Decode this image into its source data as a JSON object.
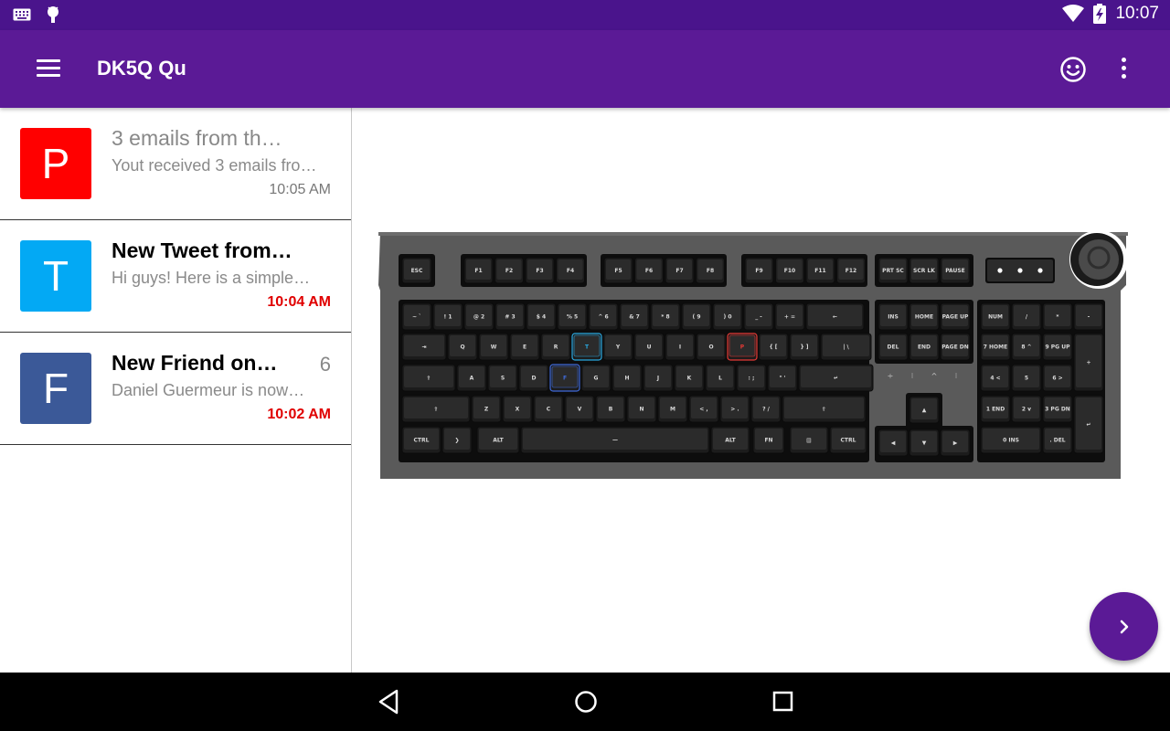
{
  "status_bar": {
    "time": "10:07"
  },
  "app_bar": {
    "title": "DK5Q Qu"
  },
  "list": {
    "items": [
      {
        "avatar_letter": "P",
        "avatar_color": "#ff0000",
        "title": "3 emails from th…",
        "preview": "Yout received 3 emails fro…",
        "time": "10:05 AM",
        "count": "",
        "unread": false
      },
      {
        "avatar_letter": "T",
        "avatar_color": "#03a9f4",
        "title": "New Tweet from…",
        "preview": "Hi guys! Here is a simple…",
        "time": "10:04 AM",
        "count": "",
        "unread": true
      },
      {
        "avatar_letter": "F",
        "avatar_color": "#3b5998",
        "title": "New Friend on…",
        "preview": "Daniel Guermeur is now…",
        "time": "10:02 AM",
        "count": "6",
        "unread": true
      }
    ]
  },
  "keyboard": {
    "function_row": [
      "ESC",
      "F1",
      "F2",
      "F3",
      "F4",
      "F5",
      "F6",
      "F7",
      "F8",
      "F9",
      "F10",
      "F11",
      "F12",
      "PRT SC",
      "SCR LK",
      "PAUSE"
    ],
    "row1": [
      "~ `",
      "! 1",
      "@ 2",
      "# 3",
      "$ 4",
      "% 5",
      "^ 6",
      "& 7",
      "* 8",
      "( 9",
      ") 0",
      "_ -",
      "+ ="
    ],
    "row2": [
      "Q",
      "W",
      "E",
      "R",
      "T",
      "Y",
      "U",
      "I",
      "O",
      "P",
      "{ [",
      "} ]",
      "| \\"
    ],
    "row3": [
      "A",
      "S",
      "D",
      "F",
      "G",
      "H",
      "J",
      "K",
      "L",
      ": ;",
      "\" '"
    ],
    "row4": [
      "Z",
      "X",
      "C",
      "V",
      "B",
      "N",
      "M",
      "< ,",
      "> .",
      "? /"
    ],
    "row5": [
      "CTRL",
      "ALT",
      "ALT",
      "FN",
      "CTRL"
    ],
    "nav_cluster": [
      "INS",
      "HOME",
      "PAGE UP",
      "DEL",
      "END",
      "PAGE DN"
    ],
    "numpad": [
      "NUM",
      "/",
      "*",
      "-",
      "7 HOME",
      "8 ^",
      "9 PG UP",
      "+",
      "4 <",
      "5",
      "6 >",
      "1 END",
      "2 v",
      "3 PG DN",
      "0 INS",
      ". DEL"
    ],
    "highlight_colors": {
      "T": "#2aa8e0",
      "P": "#e53935",
      "F": "#3f6ad8"
    }
  },
  "colors": {
    "status_bar": "#4a148c",
    "app_bar": "#5b1a96",
    "accent": "#5b1a96",
    "unread_time": "#e00000"
  }
}
